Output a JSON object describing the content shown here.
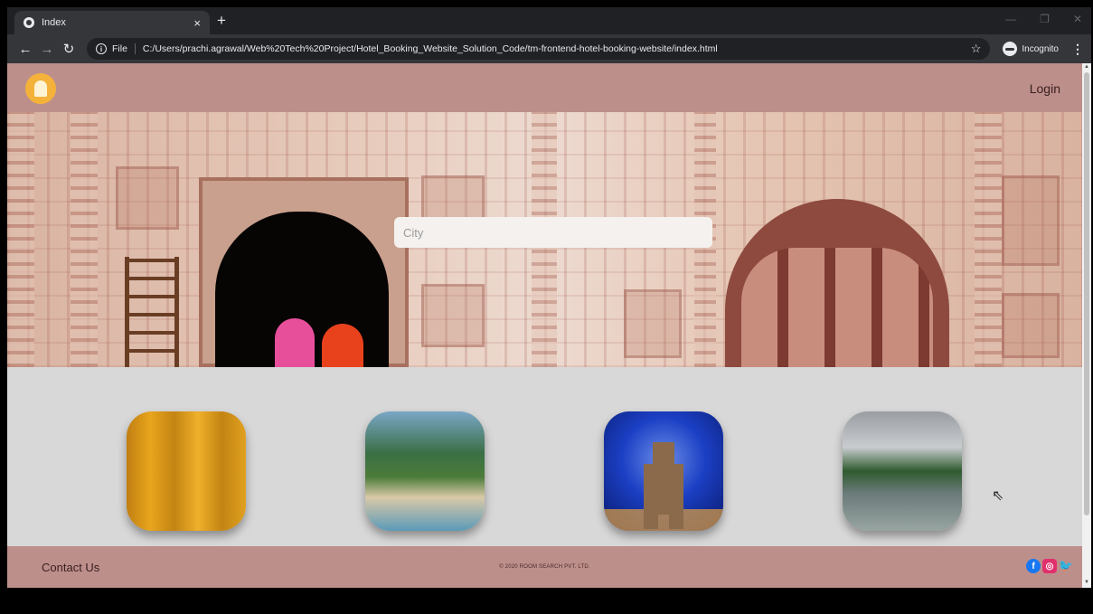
{
  "browser": {
    "tab_title": "Index",
    "tab_close": "×",
    "new_tab": "+",
    "file_label": "File",
    "url": "C:/Users/prachi.agrawal/Web%20Tech%20Project/Hotel_Booking_Website_Solution_Code/tm-frontend-hotel-booking-website/index.html",
    "incognito_label": "Incognito",
    "star_icon": "☆",
    "kebab_icon": "⋮"
  },
  "header": {
    "login_label": "Login"
  },
  "search": {
    "placeholder": "City",
    "value": ""
  },
  "cities": [
    {
      "icon": "city-image-1"
    },
    {
      "icon": "city-image-2"
    },
    {
      "icon": "city-image-3"
    },
    {
      "icon": "city-image-4"
    }
  ],
  "footer": {
    "contact_label": "Contact Us",
    "copyright": "© 2020 ROOM SEARCH PVT. LTD.",
    "social": [
      "facebook-icon",
      "instagram-icon",
      "twitter-icon"
    ]
  },
  "colors": {
    "header_bg": "#bd8f8b",
    "page_bg": "#d8d8d8",
    "logo": "#f4b23a"
  }
}
